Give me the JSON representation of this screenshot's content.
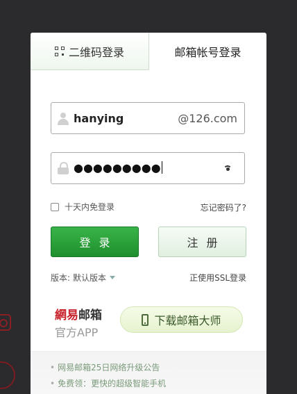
{
  "tabs": {
    "qr_label": "二维码登录",
    "mail_label": "邮箱帐号登录"
  },
  "username": {
    "value": "hanying",
    "suffix": "@126.com"
  },
  "password": {
    "masked_value": "●●●●●●●●●"
  },
  "remember": {
    "label": "十天内免登录",
    "checked": false
  },
  "forgot_label": "忘记密码了?",
  "buttons": {
    "login": "登录",
    "register": "注册"
  },
  "version": {
    "label": "版本:",
    "selected": "默认版本"
  },
  "ssl_label": "正使用SSL登录",
  "app_promo": {
    "logo_top_red": "網易",
    "logo_top_dark": "邮箱",
    "logo_bottom": "官方APP",
    "download_label": "下载邮箱大师"
  },
  "news": [
    "网易邮箱25日网络升级公告",
    "免费领：更快的超级智能手机"
  ],
  "colors": {
    "primary_green": "#2a9e3a",
    "background": "#2b2b2e",
    "brand_red": "#c8232c"
  }
}
